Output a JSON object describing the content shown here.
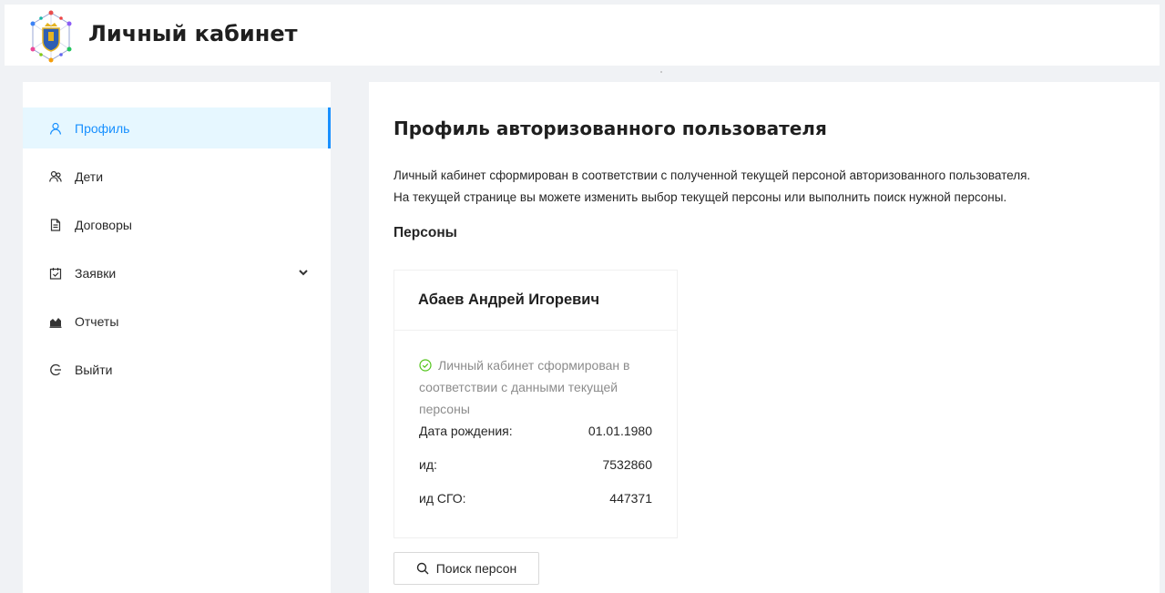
{
  "header": {
    "title": "Личный кабинет",
    "logo_icon": "regional-emblem-logo"
  },
  "sidebar": {
    "items": [
      {
        "label": "Профиль",
        "icon": "user-icon",
        "active": true
      },
      {
        "label": "Дети",
        "icon": "users-icon"
      },
      {
        "label": "Договоры",
        "icon": "file-text-icon"
      },
      {
        "label": "Заявки",
        "icon": "carry-out-icon",
        "has_submenu": true
      },
      {
        "label": "Отчеты",
        "icon": "area-chart-icon"
      },
      {
        "label": "Выйти",
        "icon": "logout-icon"
      }
    ]
  },
  "main": {
    "title": "Профиль авторизованного пользователя",
    "description_line1": "Личный кабинет сформирован в соответствии с полученной текущей персоной авторизованного пользователя.",
    "description_line2": "На текущей странице  вы можете изменить выбор текущей персоны или выполнить поиск нужной персоны.",
    "persons_heading": "Персоны",
    "person_card": {
      "name": "Абаев Андрей Игоревич",
      "status": "Личный кабинет сформирован в соответствии с данными текущей персоны",
      "fields": [
        {
          "label": "Дата рождения:",
          "value": "01.01.1980"
        },
        {
          "label": "ид:",
          "value": "7532860"
        },
        {
          "label": "ид СГО:",
          "value": "447371"
        }
      ]
    },
    "search_button": "Поиск персон"
  },
  "colors": {
    "accent": "#1890ff",
    "active_bg": "#e6f7ff",
    "success": "#52c41a",
    "page_bg": "#f0f2f5"
  }
}
